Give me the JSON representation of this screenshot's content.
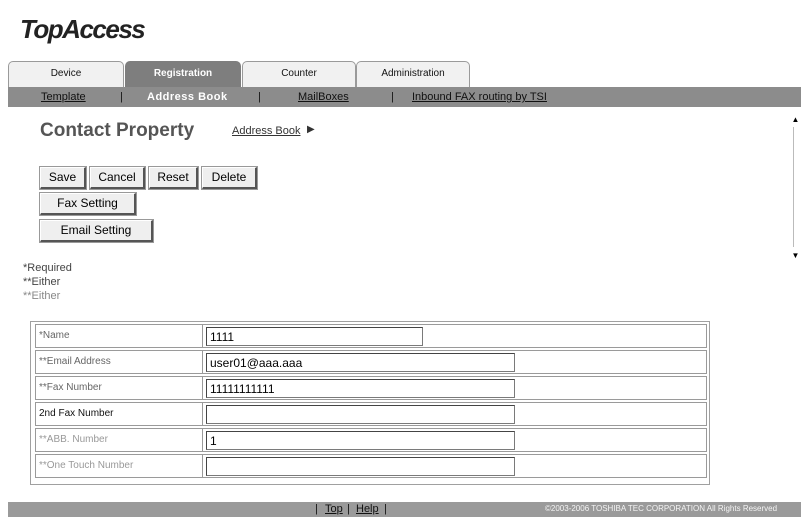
{
  "brand": {
    "logo": "TopAccess"
  },
  "tabs": [
    {
      "label": "Device"
    },
    {
      "label": "Registration"
    },
    {
      "label": "Counter"
    },
    {
      "label": "Administration"
    }
  ],
  "subnav": {
    "template": "Template",
    "sep1": "|",
    "address_book": "Address Book",
    "sep2": "|",
    "mailboxes": "MailBoxes",
    "sep3": "|",
    "inbound": "Inbound FAX routing by TSI"
  },
  "page": {
    "title": "Contact Property",
    "breadcrumb": "Address Book",
    "breadcrumb_arrow": "▶"
  },
  "buttons": {
    "save": "Save",
    "cancel": "Cancel",
    "reset": "Reset",
    "delete": "Delete",
    "fax_setting": "Fax Setting",
    "email_setting": "Email Setting"
  },
  "notes": [
    "*Required",
    "**Either",
    "**Either"
  ],
  "form": {
    "rows": [
      {
        "label": "*Name",
        "value": "1111"
      },
      {
        "label": "**Email Address",
        "value": "user01@aaa.aaa"
      },
      {
        "label": "**Fax Number",
        "value": "11111111111"
      },
      {
        "label": "2nd Fax Number",
        "value": ""
      },
      {
        "label": "**ABB. Number",
        "value": "1"
      },
      {
        "label": "**One Touch Number",
        "value": ""
      }
    ]
  },
  "footer": {
    "sep_a": "|",
    "top": "Top",
    "sep_b": "|",
    "help": "Help",
    "sep_c": "|",
    "copyright": "©2003-2006 TOSHIBA TEC CORPORATION All Rights Reserved"
  },
  "scrollbar": {
    "up_glyph": "▲",
    "down_glyph": "▼"
  }
}
